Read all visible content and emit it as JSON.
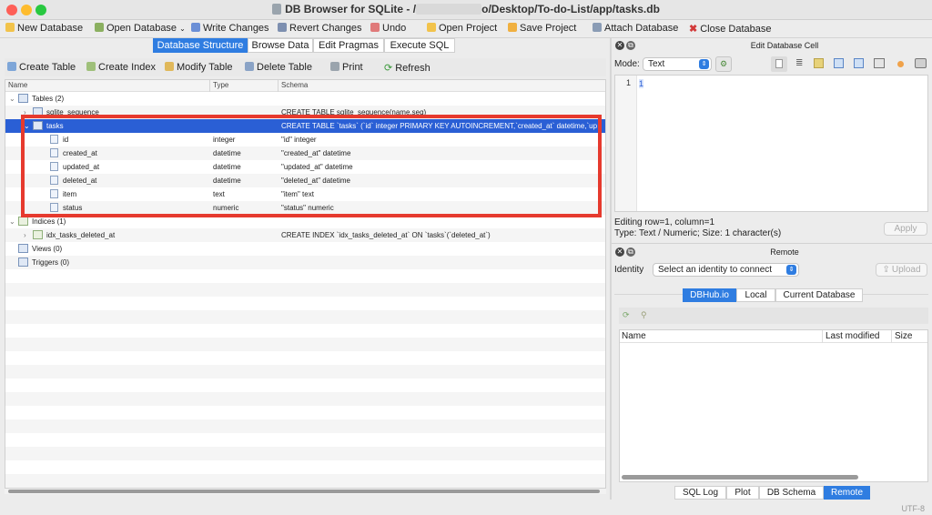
{
  "window": {
    "title_prefix": "DB Browser for SQLite - /",
    "title_suffix": "o/Desktop/To-do-List/app/tasks.db"
  },
  "colors": {
    "accent": "#2f7de1",
    "selection": "#2a5fd5",
    "highlight_box": "#e63a2e"
  },
  "toolbar": {
    "new_database": "New Database",
    "open_database": "Open Database",
    "write_changes": "Write Changes",
    "revert_changes": "Revert Changes",
    "undo": "Undo",
    "open_project": "Open Project",
    "save_project": "Save Project",
    "attach_database": "Attach Database",
    "close_database": "Close Database"
  },
  "main_tabs": [
    "Database Structure",
    "Browse Data",
    "Edit Pragmas",
    "Execute SQL"
  ],
  "structure_toolbar": {
    "create_table": "Create Table",
    "create_index": "Create Index",
    "modify_table": "Modify Table",
    "delete_table": "Delete Table",
    "print": "Print",
    "refresh": "Refresh"
  },
  "tree": {
    "columns": [
      "Name",
      "Type",
      "Schema"
    ],
    "rows": [
      {
        "name": "Tables (2)",
        "type": "",
        "schema": ""
      },
      {
        "name": "sqlite_sequence",
        "type": "",
        "schema": "CREATE TABLE sqlite_sequence(name,seq)"
      },
      {
        "name": "tasks",
        "type": "",
        "schema": "CREATE TABLE `tasks` (`id` integer PRIMARY KEY AUTOINCREMENT,`created_at` datetime,`up"
      },
      {
        "name": "id",
        "type": "integer",
        "schema": "\"id\" integer"
      },
      {
        "name": "created_at",
        "type": "datetime",
        "schema": "\"created_at\" datetime"
      },
      {
        "name": "updated_at",
        "type": "datetime",
        "schema": "\"updated_at\" datetime"
      },
      {
        "name": "deleted_at",
        "type": "datetime",
        "schema": "\"deleted_at\" datetime"
      },
      {
        "name": "item",
        "type": "text",
        "schema": "\"item\" text"
      },
      {
        "name": "status",
        "type": "numeric",
        "schema": "\"status\" numeric"
      },
      {
        "name": "Indices (1)",
        "type": "",
        "schema": ""
      },
      {
        "name": "idx_tasks_deleted_at",
        "type": "",
        "schema": "CREATE INDEX `idx_tasks_deleted_at` ON `tasks`(`deleted_at`)"
      },
      {
        "name": "Views (0)",
        "type": "",
        "schema": ""
      },
      {
        "name": "Triggers (0)",
        "type": "",
        "schema": ""
      }
    ]
  },
  "edit_cell": {
    "header": "Edit Database Cell",
    "mode_label": "Mode:",
    "mode_value": "Text",
    "line_number": "1",
    "cell_value": "1",
    "status_line1": "Editing row=1, column=1",
    "status_line2": "Type: Text / Numeric; Size: 1 character(s)",
    "apply": "Apply"
  },
  "remote": {
    "header": "Remote",
    "identity_label": "Identity",
    "identity_select": "Select an identity to connect",
    "upload": "Upload",
    "tabs": [
      "DBHub.io",
      "Local",
      "Current Database"
    ],
    "columns": [
      "Name",
      "Last modified",
      "Size"
    ]
  },
  "bottom_tabs": [
    "SQL Log",
    "Plot",
    "DB Schema",
    "Remote"
  ],
  "status": {
    "encoding": "UTF-8"
  }
}
